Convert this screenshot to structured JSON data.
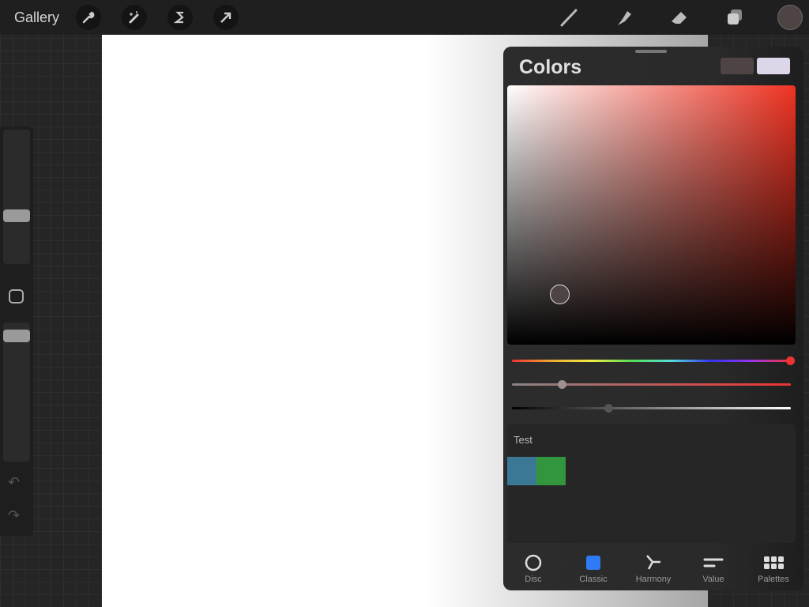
{
  "topbar": {
    "gallery_label": "Gallery",
    "left_tools": [
      "wrench-icon",
      "magic-wand-icon",
      "selection-icon",
      "transform-arrow-icon"
    ],
    "right_tools": [
      "brush-icon",
      "smudge-icon",
      "eraser-icon",
      "layers-icon"
    ],
    "current_color": "#4e4444"
  },
  "sidebar": {
    "brush_size": 0.55,
    "opacity": 0.95
  },
  "colors": {
    "title": "Colors",
    "primary_color": "#4e4444",
    "secondary_color": "#dcd6e8",
    "hue": 0,
    "saturation": 0.18,
    "brightness": 0.35,
    "palette": {
      "name": "Test",
      "swatches": [
        "#3a7896",
        "#32963e"
      ]
    },
    "tabs": [
      {
        "label": "Disc",
        "icon": "disc-icon"
      },
      {
        "label": "Classic",
        "icon": "classic-icon"
      },
      {
        "label": "Harmony",
        "icon": "harmony-icon"
      },
      {
        "label": "Value",
        "icon": "value-icon"
      },
      {
        "label": "Palettes",
        "icon": "palettes-icon"
      }
    ],
    "active_tab": "Classic",
    "accent": "#2f7bf5"
  }
}
